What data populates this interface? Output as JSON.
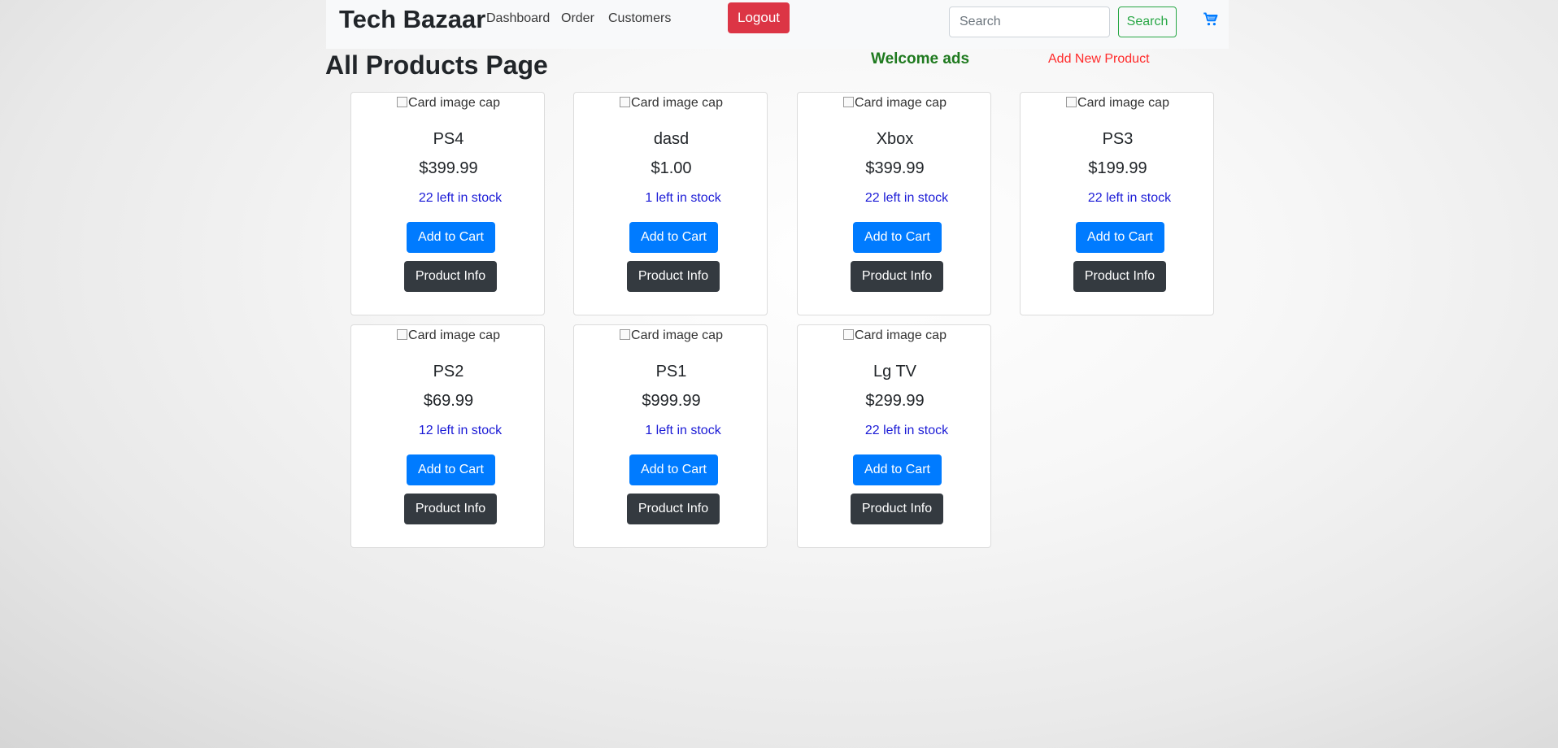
{
  "nav": {
    "brand": "Tech Bazaar",
    "links": [
      "Dashboard",
      "Order",
      "Customers"
    ],
    "logout_label": "Logout",
    "search_placeholder": "Search",
    "search_label": "Search",
    "cart_icon": "shopping-cart-icon"
  },
  "page": {
    "title": "All Products Page",
    "welcome": "Welcome ads",
    "add_product_label": "Add New Product"
  },
  "colors": {
    "logout": "#dc3545",
    "add_to_cart": "#007bff",
    "product_info": "#343a40",
    "search_outline": "#28a745",
    "welcome": "#1f7a1f",
    "add_new_product": "#ff2a2a",
    "stock": "#1a1ad6"
  },
  "products": [
    {
      "name": "PS4",
      "price": "$399.99",
      "stock": "22 left in stock",
      "image_alt": "Card image cap",
      "cart_label": "Add to Cart",
      "info_label": "Product Info"
    },
    {
      "name": "dasd",
      "price": "$1.00",
      "stock": "1 left in stock",
      "image_alt": "Card image cap",
      "cart_label": "Add to Cart",
      "info_label": "Product Info"
    },
    {
      "name": "Xbox",
      "price": "$399.99",
      "stock": "22 left in stock",
      "image_alt": "Card image cap",
      "cart_label": "Add to Cart",
      "info_label": "Product Info"
    },
    {
      "name": "PS3",
      "price": "$199.99",
      "stock": "22 left in stock",
      "image_alt": "Card image cap",
      "cart_label": "Add to Cart",
      "info_label": "Product Info"
    },
    {
      "name": "PS2",
      "price": "$69.99",
      "stock": "12 left in stock",
      "image_alt": "Card image cap",
      "cart_label": "Add to Cart",
      "info_label": "Product Info"
    },
    {
      "name": "PS1",
      "price": "$999.99",
      "stock": "1 left in stock",
      "image_alt": "Card image cap",
      "cart_label": "Add to Cart",
      "info_label": "Product Info"
    },
    {
      "name": "Lg TV",
      "price": "$299.99",
      "stock": "22 left in stock",
      "image_alt": "Card image cap",
      "cart_label": "Add to Cart",
      "info_label": "Product Info"
    }
  ]
}
